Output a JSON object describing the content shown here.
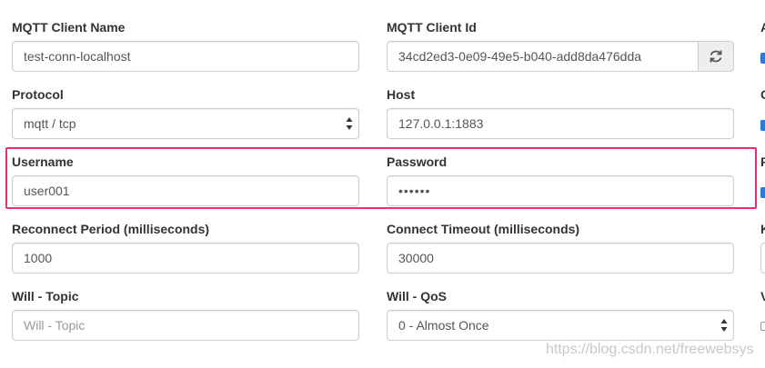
{
  "fields": {
    "client_name": {
      "label": "MQTT Client Name",
      "value": "test-conn-localhost"
    },
    "client_id": {
      "label": "MQTT Client Id",
      "value": "34cd2ed3-0e09-49e5-b040-add8da476dda",
      "refresh_icon": "refresh-icon"
    },
    "protocol": {
      "label": "Protocol",
      "value": "mqtt / tcp"
    },
    "host": {
      "label": "Host",
      "value": "127.0.0.1:1883"
    },
    "username": {
      "label": "Username",
      "value": "user001"
    },
    "password": {
      "label": "Password",
      "value": "••••••"
    },
    "reconnect_period": {
      "label": "Reconnect Period (milliseconds)",
      "value": "1000"
    },
    "connect_timeout": {
      "label": "Connect Timeout (milliseconds)",
      "value": "30000"
    },
    "will_topic": {
      "label": "Will - Topic",
      "placeholder": "Will - Topic"
    },
    "will_qos": {
      "label": "Will - QoS",
      "value": "0 - Almost Once"
    }
  },
  "right_edge": {
    "letters": [
      "A",
      "C",
      "F",
      "K",
      "V"
    ]
  },
  "watermark": "https://blog.csdn.net/freewebsys",
  "colors": {
    "highlight": "#e8306f",
    "checkbox": "#2a7ad6"
  }
}
